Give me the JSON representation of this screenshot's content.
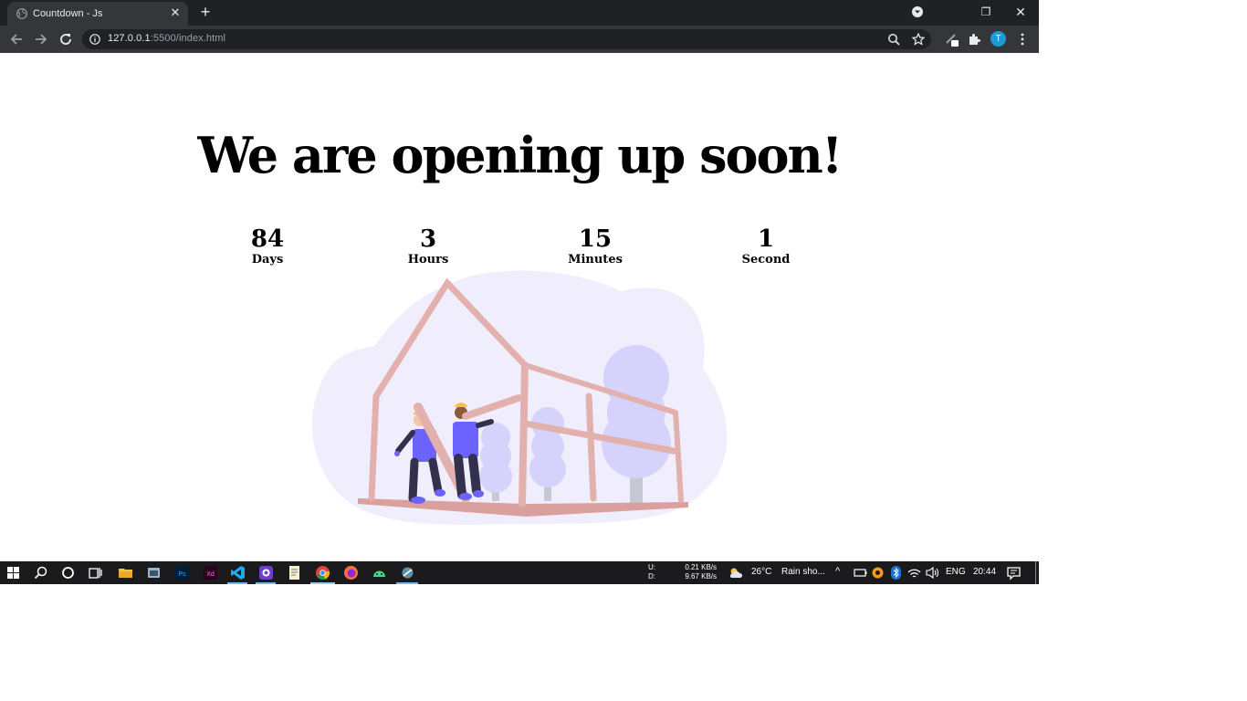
{
  "browser": {
    "tab_title": "Countdown - Js",
    "url_host": "127.0.0.1",
    "url_rest": ":5500/index.html",
    "profile_initial": "T"
  },
  "page": {
    "headline": "We are opening up soon!",
    "countdown": [
      {
        "value": "84",
        "label": "Days"
      },
      {
        "value": "3",
        "label": "Hours"
      },
      {
        "value": "15",
        "label": "Minutes"
      },
      {
        "value": "1",
        "label": "Second"
      }
    ]
  },
  "taskbar": {
    "upload_label": "U:",
    "download_label": "D:",
    "upload_speed": "0.21 KB/s",
    "download_speed": "9.67 KB/s",
    "temperature": "26°C",
    "weather": "Rain sho...",
    "language": "ENG",
    "clock": "20:44"
  },
  "colors": {
    "accent": "#6c63ff",
    "wood": "#e3b1ad",
    "bg_blob": "#f0eefd"
  }
}
